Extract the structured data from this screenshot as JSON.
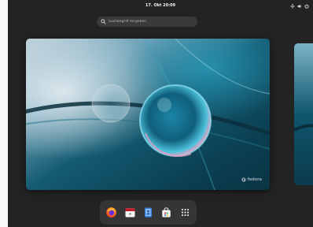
{
  "topbar": {
    "clock": "17. Okt 20:09",
    "status_icons": [
      "network-icon",
      "volume-icon",
      "power-icon"
    ]
  },
  "search": {
    "placeholder": "Suchbegriff eingeben"
  },
  "workspace": {
    "brand": "fedora"
  },
  "dash": {
    "items": [
      {
        "name": "firefox",
        "icon": "firefox-icon"
      },
      {
        "name": "calendar",
        "icon": "calendar-icon"
      },
      {
        "name": "contacts",
        "icon": "contacts-icon"
      },
      {
        "name": "software",
        "icon": "software-icon"
      },
      {
        "name": "show-apps",
        "icon": "app-grid-icon"
      }
    ]
  },
  "colors": {
    "background": "#232323",
    "search_bg": "#3a3a3a",
    "dash_bg": "#353535",
    "wallpaper_teal": "#0e5468"
  }
}
